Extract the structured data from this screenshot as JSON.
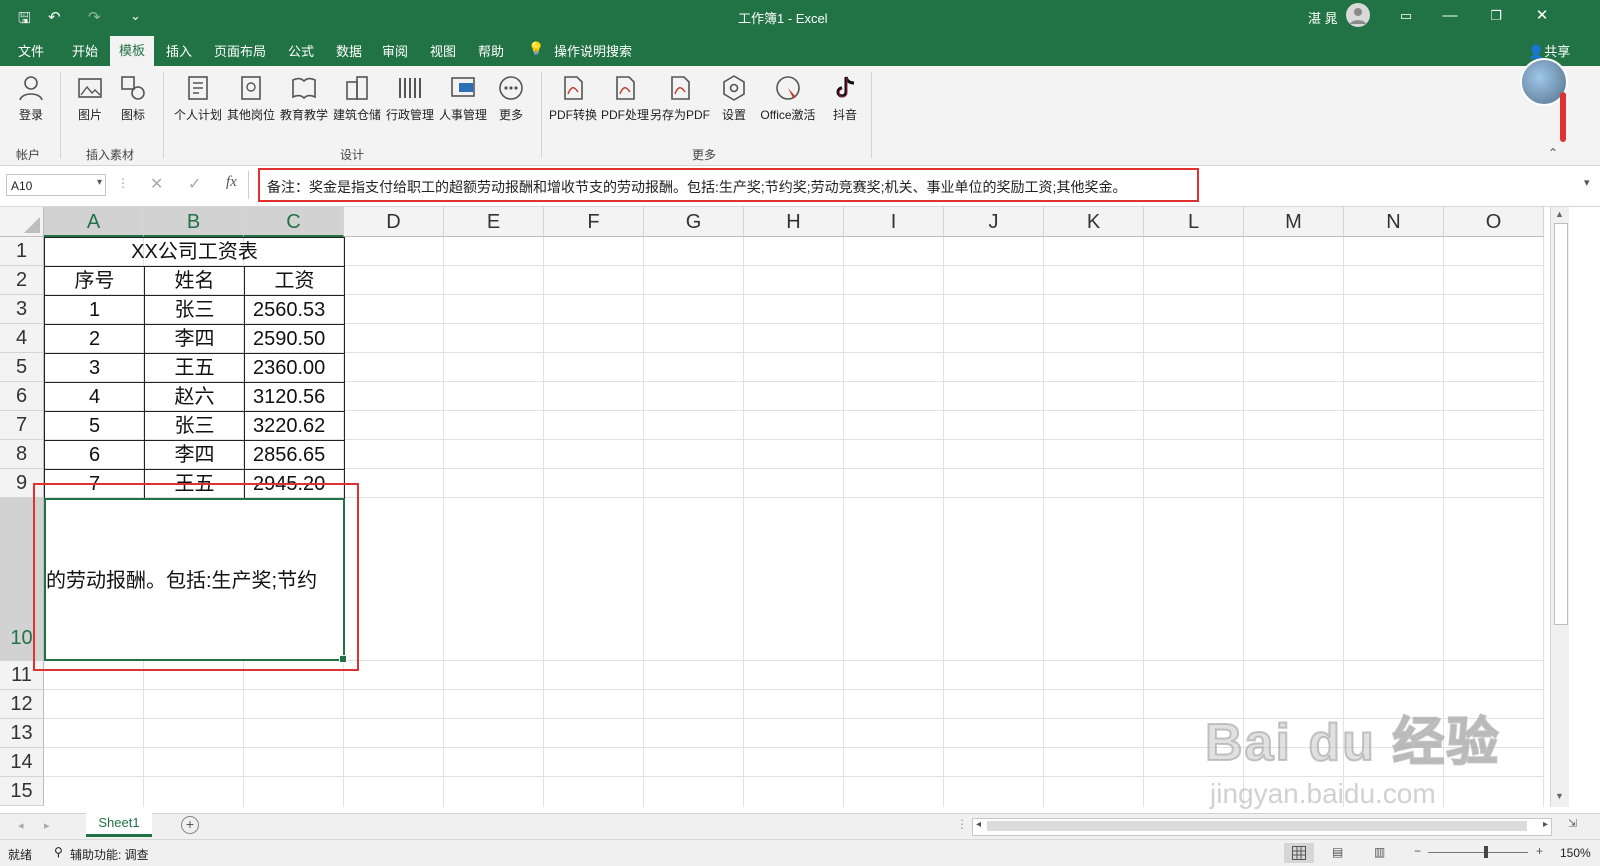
{
  "title_bar": {
    "doc_title": "工作簿1  -  Excel",
    "user_name": "湛 晁",
    "minimize": "—",
    "restore": "❐",
    "close": "✕"
  },
  "ribbon_tabs": [
    "文件",
    "开始",
    "模板",
    "插入",
    "页面布局",
    "公式",
    "数据",
    "审阅",
    "视图",
    "帮助"
  ],
  "active_tab": "模板",
  "tell_me": "操作说明搜索",
  "share": "共享",
  "ribbon": {
    "account": {
      "label": "登录",
      "group": "帐户"
    },
    "insert_material": {
      "items": [
        "图片",
        "图标"
      ],
      "group": "插入素材"
    },
    "design": {
      "items": [
        "个人计划",
        "其他岗位",
        "教育教学",
        "建筑仓储",
        "行政管理",
        "人事管理",
        "更多"
      ],
      "group": "设计"
    },
    "more": {
      "items": [
        "PDF转换",
        "PDF处理",
        "另存为PDF",
        "设置",
        "Office激活",
        "抖音"
      ],
      "group": "更多"
    }
  },
  "formula_bar": {
    "name_box": "A10",
    "fx": "fx",
    "content": "备注：奖金是指支付给职工的超额劳动报酬和增收节支的劳动报酬。包括:生产奖;节约奖;劳动竞赛奖;机关、事业单位的奖励工资;其他奖金。"
  },
  "columns": [
    "A",
    "B",
    "C",
    "D",
    "E",
    "F",
    "G",
    "H",
    "I",
    "J",
    "K",
    "L",
    "M",
    "N",
    "O"
  ],
  "rows": [
    "1",
    "2",
    "3",
    "4",
    "5",
    "6",
    "7",
    "8",
    "9",
    "10",
    "11",
    "12",
    "13",
    "14",
    "15"
  ],
  "table": {
    "title": "XX公司工资表",
    "headers": [
      "序号",
      "姓名",
      "工资"
    ],
    "rows": [
      [
        "1",
        "张三",
        "2560.53"
      ],
      [
        "2",
        "李四",
        "2590.50"
      ],
      [
        "3",
        "王五",
        "2360.00"
      ],
      [
        "4",
        "赵六",
        "3120.56"
      ],
      [
        "5",
        "张三",
        "3220.62"
      ],
      [
        "6",
        "李四",
        "2856.65"
      ],
      [
        "7",
        "王五",
        "2945.20"
      ]
    ]
  },
  "a10_visible_text": "的劳动报酬。包括:生产奖;节约",
  "sheet_tabs": [
    "Sheet1"
  ],
  "status": {
    "ready": "就绪",
    "accessibility": "辅助功能: 调查",
    "zoom": "150%"
  },
  "watermark": {
    "logo": "Bai du 经验",
    "url": "jingyan.baidu.com"
  },
  "colors": {
    "accent": "#217346",
    "highlight": "#e03030"
  }
}
